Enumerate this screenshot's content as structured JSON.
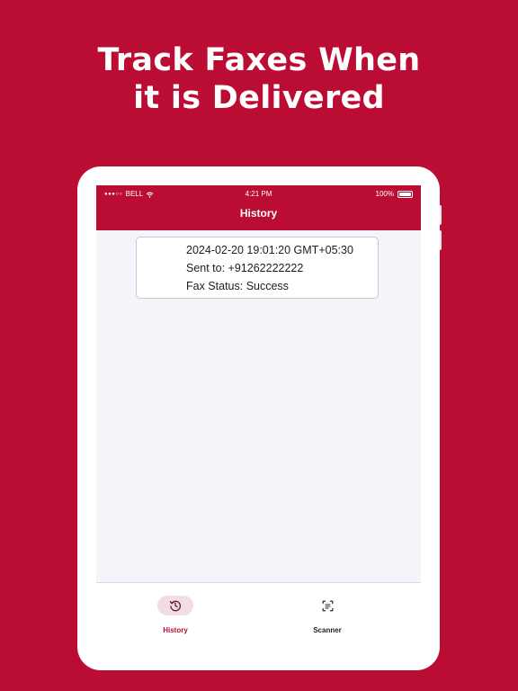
{
  "headline": {
    "line1": "Track Faxes When",
    "line2": "it is Delivered"
  },
  "status_bar": {
    "carrier": "BELL",
    "time": "4:21 PM",
    "battery": "100%"
  },
  "app_bar": {
    "title": "History"
  },
  "history_items": [
    {
      "datetime": "2024-02-20 19:01:20 GMT+05:30",
      "sent_to": "Sent to: +91262222222",
      "status": "Fax Status: Success"
    }
  ],
  "bottom_nav": {
    "items": [
      {
        "label": "History",
        "icon": "history-icon",
        "active": true
      },
      {
        "label": "Scanner",
        "icon": "scan-icon",
        "active": false
      }
    ]
  },
  "colors": {
    "brand": "#bb0d33",
    "active_pill": "#f0dde6"
  }
}
